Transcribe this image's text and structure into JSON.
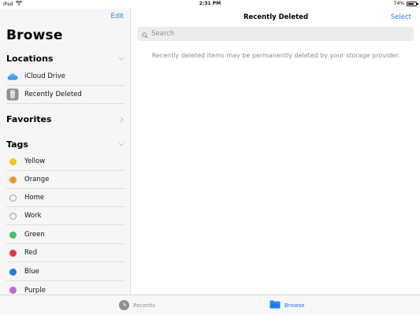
{
  "status_bar": {
    "device": "iPad",
    "time": "2:31 PM",
    "battery": "74%",
    "battery_level": 0.74
  },
  "sidebar": {
    "edit_label": "Edit",
    "title": "Browse",
    "locations": {
      "header": "Locations",
      "items": [
        {
          "label": "iCloud Drive",
          "icon": "icloud-icon"
        },
        {
          "label": "Recently Deleted",
          "icon": "trash-icon"
        }
      ]
    },
    "favorites": {
      "header": "Favorites"
    },
    "tags": {
      "header": "Tags",
      "items": [
        {
          "label": "Yellow",
          "color": "#f5c518"
        },
        {
          "label": "Orange",
          "color": "#f7941d"
        },
        {
          "label": "Home",
          "color": ""
        },
        {
          "label": "Work",
          "color": ""
        },
        {
          "label": "Green",
          "color": "#3ec95a"
        },
        {
          "label": "Red",
          "color": "#e8393a"
        },
        {
          "label": "Blue",
          "color": "#1a7cf5"
        },
        {
          "label": "Purple",
          "color": "#c466d8"
        }
      ]
    }
  },
  "main": {
    "title": "Recently Deleted",
    "select_label": "Select",
    "search_placeholder": "Search",
    "message": "Recently deleted items may be permanently deleted by your storage provider."
  },
  "tab_bar": {
    "recents_label": "Recents",
    "browse_label": "Browse"
  },
  "colors": {
    "accent": "#1a7cf5",
    "secondary_text": "#8e8e93"
  }
}
